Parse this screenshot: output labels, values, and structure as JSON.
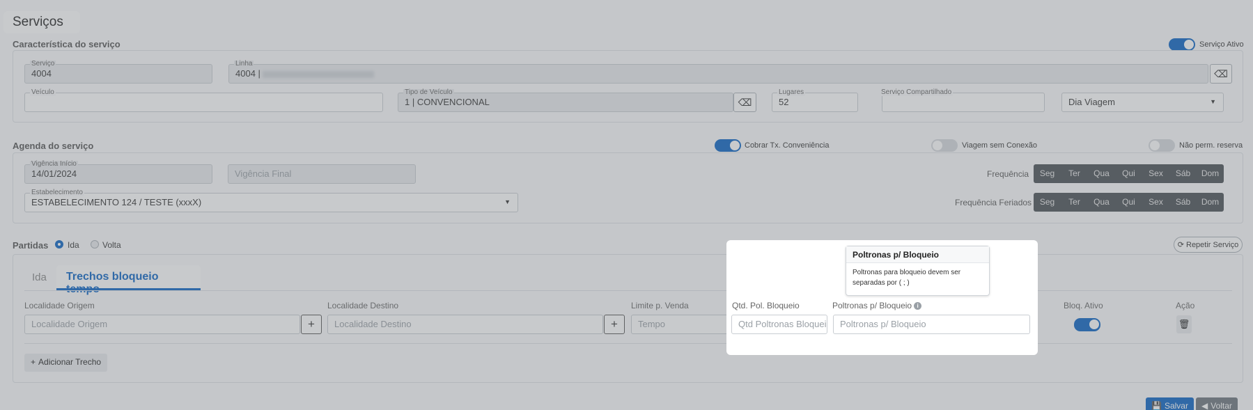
{
  "page": {
    "title": "Serviços",
    "save_label": "Salvar",
    "back_label": "Voltar"
  },
  "caracteristica": {
    "title": "Característica do serviço",
    "servico_ativo": "Serviço Ativo",
    "servico": {
      "label": "Serviço",
      "value": "4004"
    },
    "linha": {
      "label": "Linha",
      "value": "4004 |"
    },
    "veiculo": {
      "label": "Veículo",
      "value": ""
    },
    "tipo_veiculo": {
      "label": "Tipo de Veículo",
      "value": "1 | CONVENCIONAL"
    },
    "lugares": {
      "label": "Lugares",
      "value": "52"
    },
    "servico_compartilhado": {
      "label": "Serviço Compartilhado",
      "value": ""
    },
    "dia_select": "Dia Viagem"
  },
  "agenda": {
    "title": "Agenda do serviço",
    "cobrar": "Cobrar Tx. Conveniência",
    "viagem_sem_conexao": "Viagem sem Conexão",
    "nao_perm_reserva": "Não perm. reserva",
    "vigencia_inicio": {
      "label": "Vigência Início",
      "value": "14/01/2024"
    },
    "vigencia_final_placeholder": "Vigência Final",
    "frequencia": "Frequência",
    "frequencia_feriados": "Frequência Feriados",
    "days": [
      "Seg",
      "Ter",
      "Qua",
      "Qui",
      "Sex",
      "Sáb",
      "Dom"
    ],
    "estabelecimento": {
      "label": "Estabelecimento",
      "value": "ESTABELECIMENTO 124 / TESTE (xxxX)"
    }
  },
  "partidas": {
    "title": "Partidas",
    "ida": "Ida",
    "volta": "Volta",
    "repetir": "Repetir Serviço",
    "tabs": [
      "Ida",
      "Trechos bloqueio tempo"
    ],
    "columns": {
      "origem": "Localidade Origem",
      "destino": "Localidade Destino",
      "limite": "Limite p. Venda",
      "qtd": "Qtd. Pol. Bloqueio",
      "poltronas": "Poltronas p/ Bloqueio",
      "bloq": "Bloq. Ativo",
      "acao": "Ação"
    },
    "placeholders": {
      "origem": "Localidade Origem",
      "destino": "Localidade Destino",
      "tempo": "Tempo",
      "qtd": "Qtd Poltronas Bloqueio",
      "poltronas": "Poltronas p/ Bloqueio"
    },
    "add_trecho": "Adicionar Trecho"
  },
  "tooltip": {
    "title": "Poltronas p/ Bloqueio",
    "body": "Poltronas para bloqueio devem ser separadas por ( ; )"
  },
  "colors": {
    "accent": "#0a63c4",
    "dark_day": "#4a4f55"
  }
}
